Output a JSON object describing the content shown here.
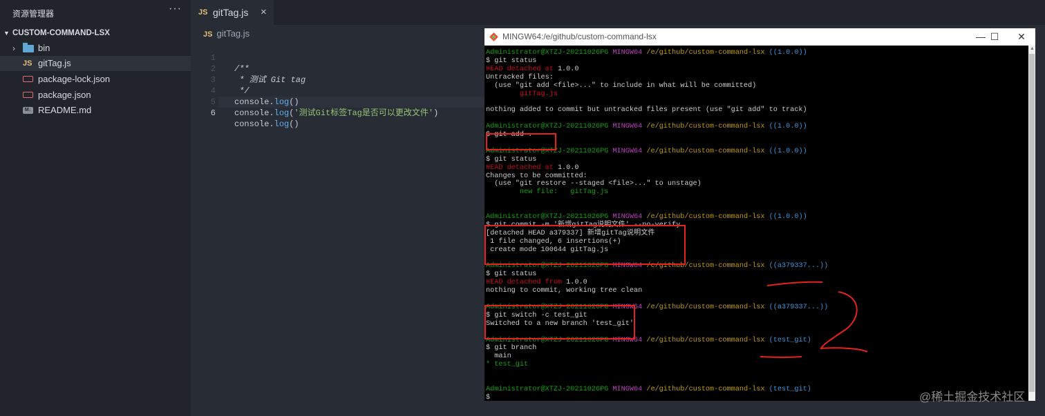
{
  "explorer": {
    "title": "资源管理器",
    "more": "···",
    "project": "CUSTOM-COMMAND-LSX",
    "items": [
      {
        "label": "bin",
        "type": "folder"
      },
      {
        "label": "gitTag.js",
        "type": "js"
      },
      {
        "label": "package-lock.json",
        "type": "json"
      },
      {
        "label": "package.json",
        "type": "json"
      },
      {
        "label": "README.md",
        "type": "md"
      }
    ],
    "js_badge": "JS",
    "md_badge": "M↓"
  },
  "editor": {
    "tab": {
      "badge": "JS",
      "label": "gitTag.js",
      "close": "×"
    },
    "breadcrumb": {
      "badge": "JS",
      "label": "gitTag.js"
    },
    "lines": [
      {
        "num": "1",
        "text": "/**"
      },
      {
        "num": "2",
        "text": " * 测试 Git tag"
      },
      {
        "num": "3",
        "text": " */"
      },
      {
        "num": "4",
        "obj": "console",
        "dot": ".",
        "fn": "log",
        "args": "()"
      },
      {
        "num": "5",
        "obj": "console",
        "dot": ".",
        "fn": "log",
        "open": "(",
        "str": "'测试Git标签Tag是否可以更改文件'",
        "close": ")"
      },
      {
        "num": "6",
        "obj": "console",
        "dot": ".",
        "fn": "log",
        "args": "()"
      }
    ]
  },
  "terminal": {
    "title": "MINGW64:/e/github/custom-command-lsx",
    "controls": {
      "minimize": "—",
      "maximize": "☐",
      "close": "✕"
    },
    "prompt": {
      "user": "Administrator@XTZJ-20211026PG",
      "sys": "MINGW64",
      "path": "/e/github/custom-command-lsx"
    },
    "lines": [
      {
        "kind": "prompt",
        "ref": "((1.0.0))"
      },
      {
        "kind": "plain",
        "text": "$ git status"
      },
      {
        "kind": "mixed",
        "a": "HEAD detached at",
        "b": " 1.0.0"
      },
      {
        "kind": "plain",
        "text": "Untracked files:"
      },
      {
        "kind": "plain",
        "text": "  (use \"git add <file>...\" to include in what will be committed)"
      },
      {
        "kind": "red",
        "text": "        gitTag.js"
      },
      {
        "kind": "blank"
      },
      {
        "kind": "plain",
        "text": "nothing added to commit but untracked files present (use \"git add\" to track)"
      },
      {
        "kind": "blank"
      },
      {
        "kind": "prompt",
        "ref": "((1.0.0))"
      },
      {
        "kind": "plain",
        "text": "$ git add ."
      },
      {
        "kind": "blank"
      },
      {
        "kind": "prompt",
        "ref": "((1.0.0))"
      },
      {
        "kind": "plain",
        "text": "$ git status"
      },
      {
        "kind": "mixed",
        "a": "HEAD detached at",
        "b": " 1.0.0"
      },
      {
        "kind": "plain",
        "text": "Changes to be committed:"
      },
      {
        "kind": "plain",
        "text": "  (use \"git restore --staged <file>...\" to unstage)"
      },
      {
        "kind": "green",
        "text": "        new file:   gitTag.js"
      },
      {
        "kind": "blank"
      },
      {
        "kind": "blank"
      },
      {
        "kind": "prompt",
        "ref": "((1.0.0))"
      },
      {
        "kind": "plain",
        "text": "$ git commit -m '新增gitTag说明文件' --no-verify"
      },
      {
        "kind": "plain",
        "text": "[detached HEAD a379337] 新增gitTag说明文件"
      },
      {
        "kind": "plain",
        "text": " 1 file changed, 6 insertions(+)"
      },
      {
        "kind": "plain",
        "text": " create mode 100644 gitTag.js"
      },
      {
        "kind": "blank"
      },
      {
        "kind": "prompt",
        "ref": "((a379337...))"
      },
      {
        "kind": "plain",
        "text": "$ git status"
      },
      {
        "kind": "mixed",
        "a": "HEAD detached from",
        "b": " 1.0.0"
      },
      {
        "kind": "plain",
        "text": "nothing to commit, working tree clean"
      },
      {
        "kind": "blank"
      },
      {
        "kind": "prompt",
        "ref": "((a379337...))"
      },
      {
        "kind": "plain",
        "text": "$ git switch -c test_git"
      },
      {
        "kind": "plain",
        "text": "Switched to a new branch 'test_git'"
      },
      {
        "kind": "blank"
      },
      {
        "kind": "prompt",
        "ref": "(test_git)"
      },
      {
        "kind": "plain",
        "text": "$ git branch"
      },
      {
        "kind": "plain",
        "text": "  main"
      },
      {
        "kind": "green",
        "text": "* test_git"
      },
      {
        "kind": "blank"
      },
      {
        "kind": "blank"
      },
      {
        "kind": "prompt",
        "ref": "(test_git)"
      },
      {
        "kind": "plain",
        "text": "$ "
      }
    ]
  },
  "watermark": "@稀土掘金技术社区",
  "colors": {
    "annotation": "#e8221b",
    "prompt_user": "#13a10e",
    "prompt_sys": "#bc3fbc",
    "prompt_path": "#c19c00",
    "prompt_ref": "#3a96dd",
    "error": "#c50f1f"
  }
}
